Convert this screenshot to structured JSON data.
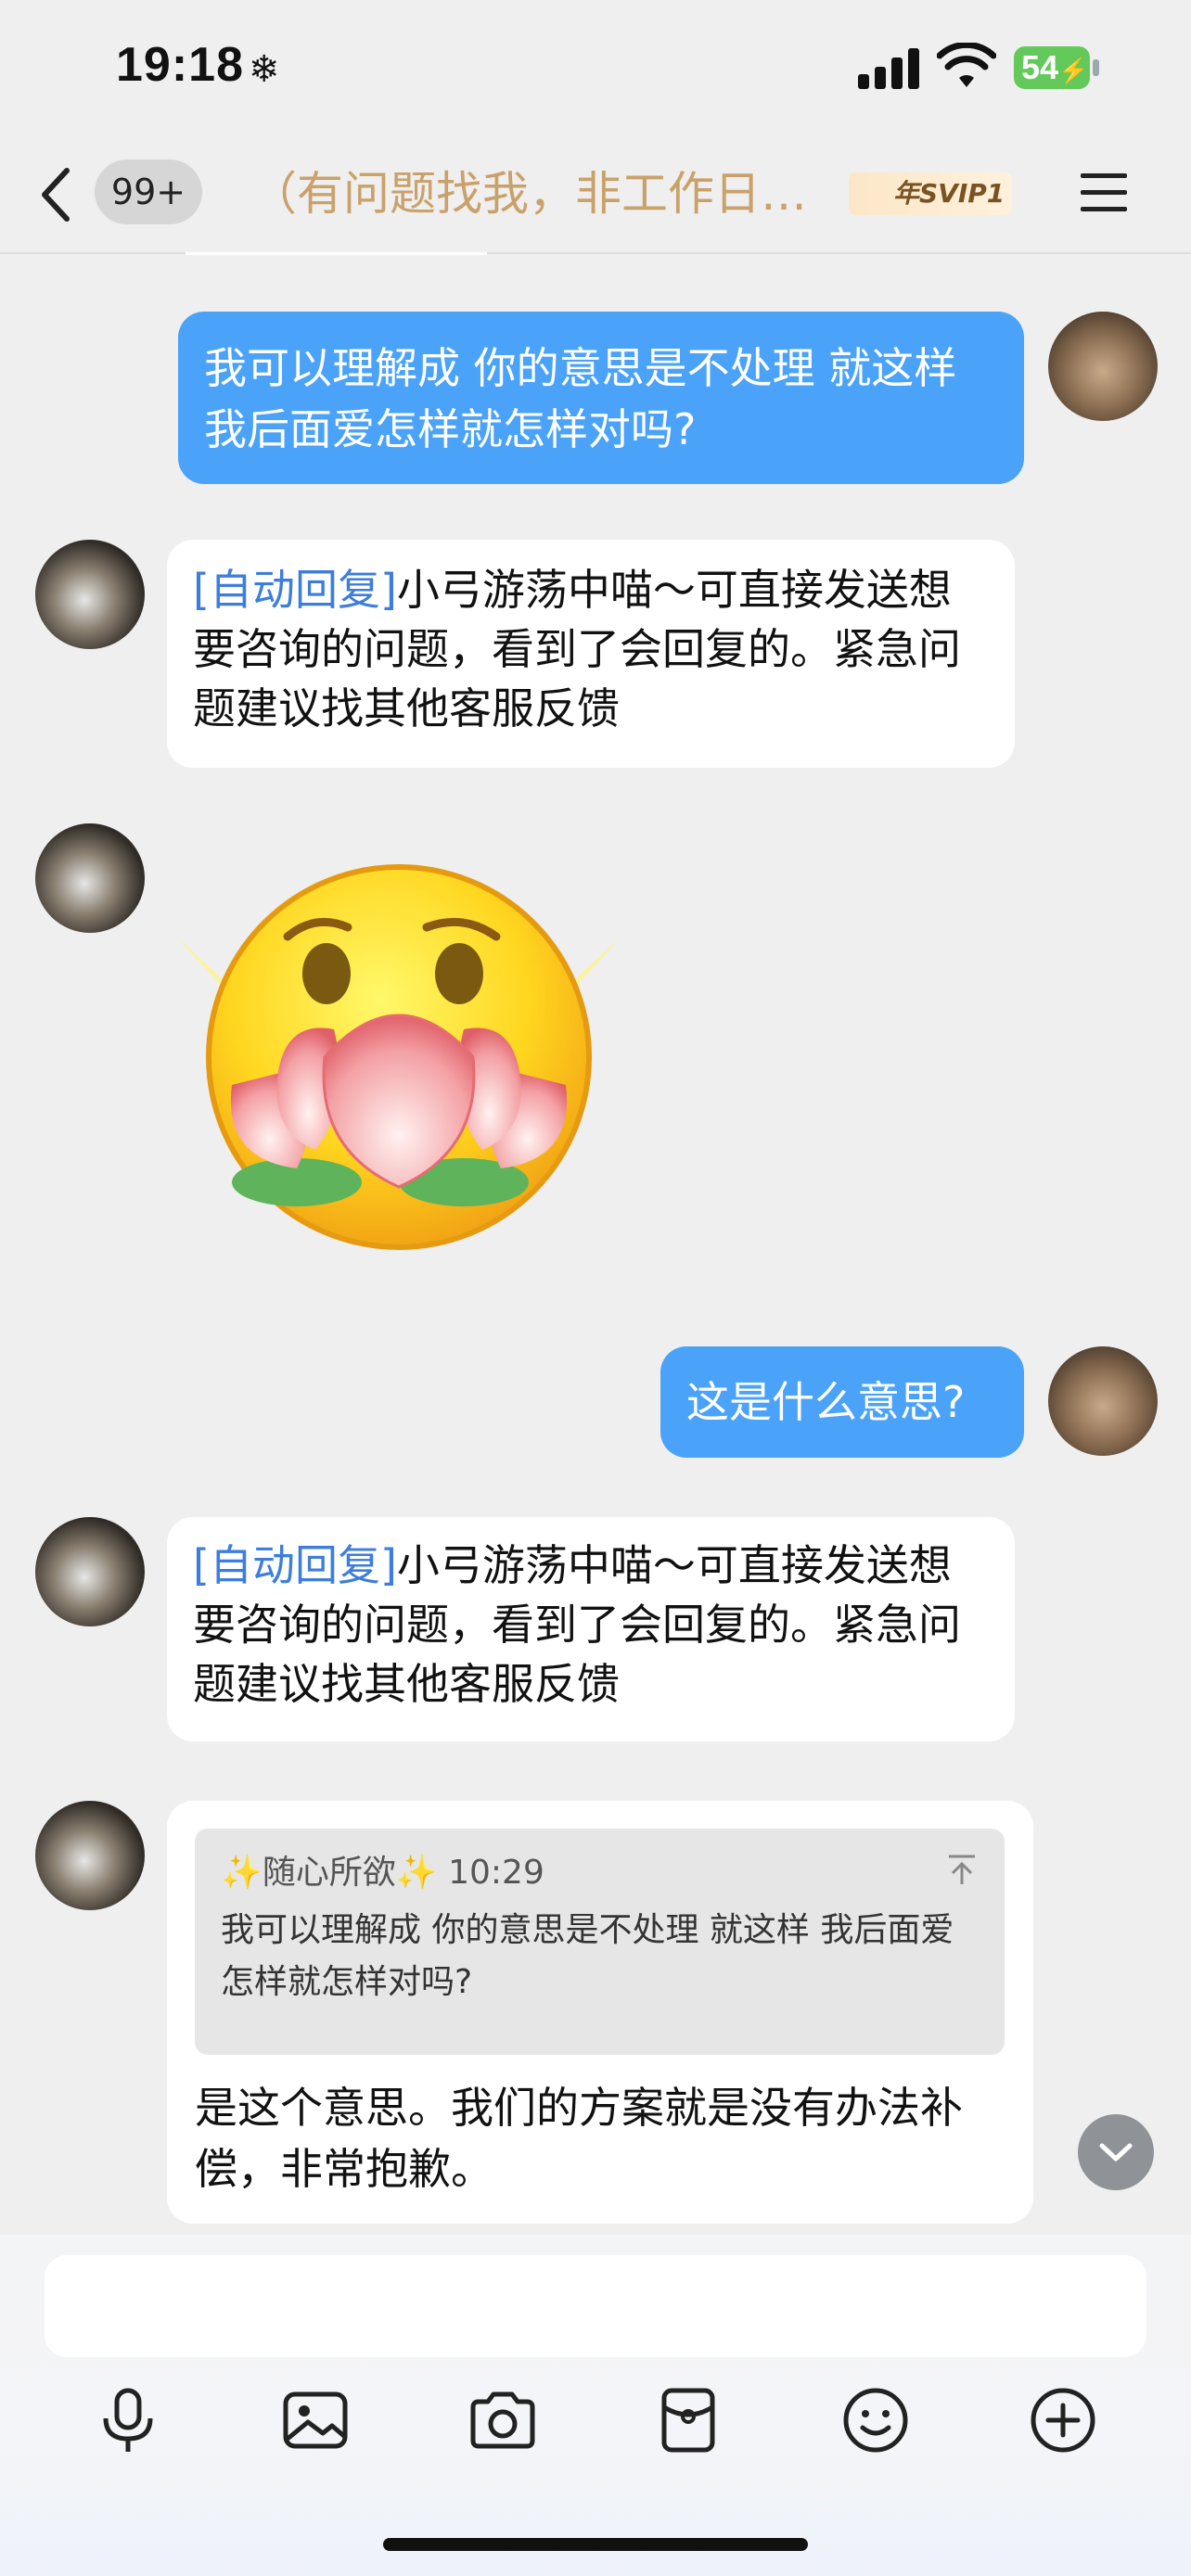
{
  "status": {
    "time": "19:18",
    "battery": "54"
  },
  "header": {
    "badge": "99+",
    "title": "（有问题找我，非工作日…",
    "vip": "年SVIP1"
  },
  "messages": {
    "m1": {
      "text": "我可以理解成 你的意思是不处理 就这样 我后面爱怎样就怎样对吗?"
    },
    "m2": {
      "auto_tag": "[自动回复]",
      "text": "小弓游荡中喵～可直接发送想要咨询的问题，看到了会回复的。紧急问题建议找其他客服反馈"
    },
    "m4": {
      "text": "这是什么意思?"
    },
    "m5": {
      "auto_tag": "[自动回复]",
      "text": "小弓游荡中喵～可直接发送想要咨询的问题，看到了会回复的。紧急问题建议找其他客服反馈"
    },
    "m6": {
      "quote_sender": "✨随心所欲✨",
      "quote_time": "10:29",
      "quote_text": "我可以理解成 你的意思是不处理 就这样 我后面爱怎样就怎样对吗?",
      "text": "是这个意思。我们的方案就是没有办法补偿，非常抱歉。"
    }
  },
  "icons": [
    "back-icon",
    "menu-icon",
    "mic-icon",
    "image-icon",
    "camera-icon",
    "red-packet-icon",
    "emoji-icon",
    "plus-icon",
    "chevron-down-icon"
  ],
  "colors": {
    "bubble_me": "#4aa3f8",
    "auto_tag": "#3d7ddc",
    "title": "#c9a16a"
  }
}
